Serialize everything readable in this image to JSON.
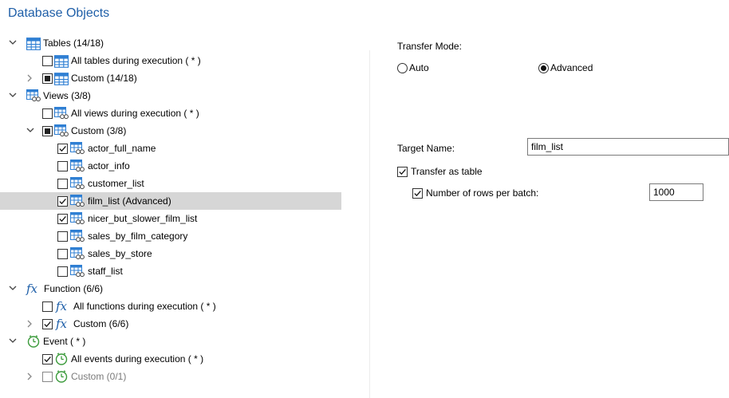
{
  "panel": {
    "title": "Database Objects"
  },
  "tree": {
    "tables": {
      "label": "Tables (14/18)",
      "all_label": "All tables during execution ( * )",
      "custom_label": "Custom (14/18)"
    },
    "views": {
      "label": "Views (3/8)",
      "all_label": "All views during execution ( * )",
      "custom_label": "Custom (3/8)",
      "items": [
        {
          "label": "actor_full_name",
          "checked": true
        },
        {
          "label": "actor_info",
          "checked": false
        },
        {
          "label": "customer_list",
          "checked": false
        },
        {
          "label": "film_list (Advanced)",
          "checked": true,
          "selected": true
        },
        {
          "label": "nicer_but_slower_film_list",
          "checked": true
        },
        {
          "label": "sales_by_film_category",
          "checked": false
        },
        {
          "label": "sales_by_store",
          "checked": false
        },
        {
          "label": "staff_list",
          "checked": false
        }
      ]
    },
    "function": {
      "label": "Function (6/6)",
      "icon_text": "fx",
      "all_label": "All functions during execution ( * )",
      "custom_label": "Custom (6/6)"
    },
    "event": {
      "label": "Event ( * )",
      "all_label": "All events during execution ( * )",
      "custom_label": "Custom (0/1)"
    }
  },
  "settings": {
    "transfer_mode_label": "Transfer Mode:",
    "mode_auto": "Auto",
    "mode_advanced": "Advanced",
    "selected_mode": "Advanced",
    "target_name_label": "Target Name:",
    "target_name_value": "film_list",
    "transfer_as_table_label": "Transfer as table",
    "rows_per_batch_label": "Number of rows per batch:",
    "rows_per_batch_value": "1000"
  },
  "colors": {
    "accent": "#1f5fa8",
    "table_icon": "#2f7fd3",
    "event_icon": "#3a9a3a",
    "selection": "#d6d6d6"
  }
}
